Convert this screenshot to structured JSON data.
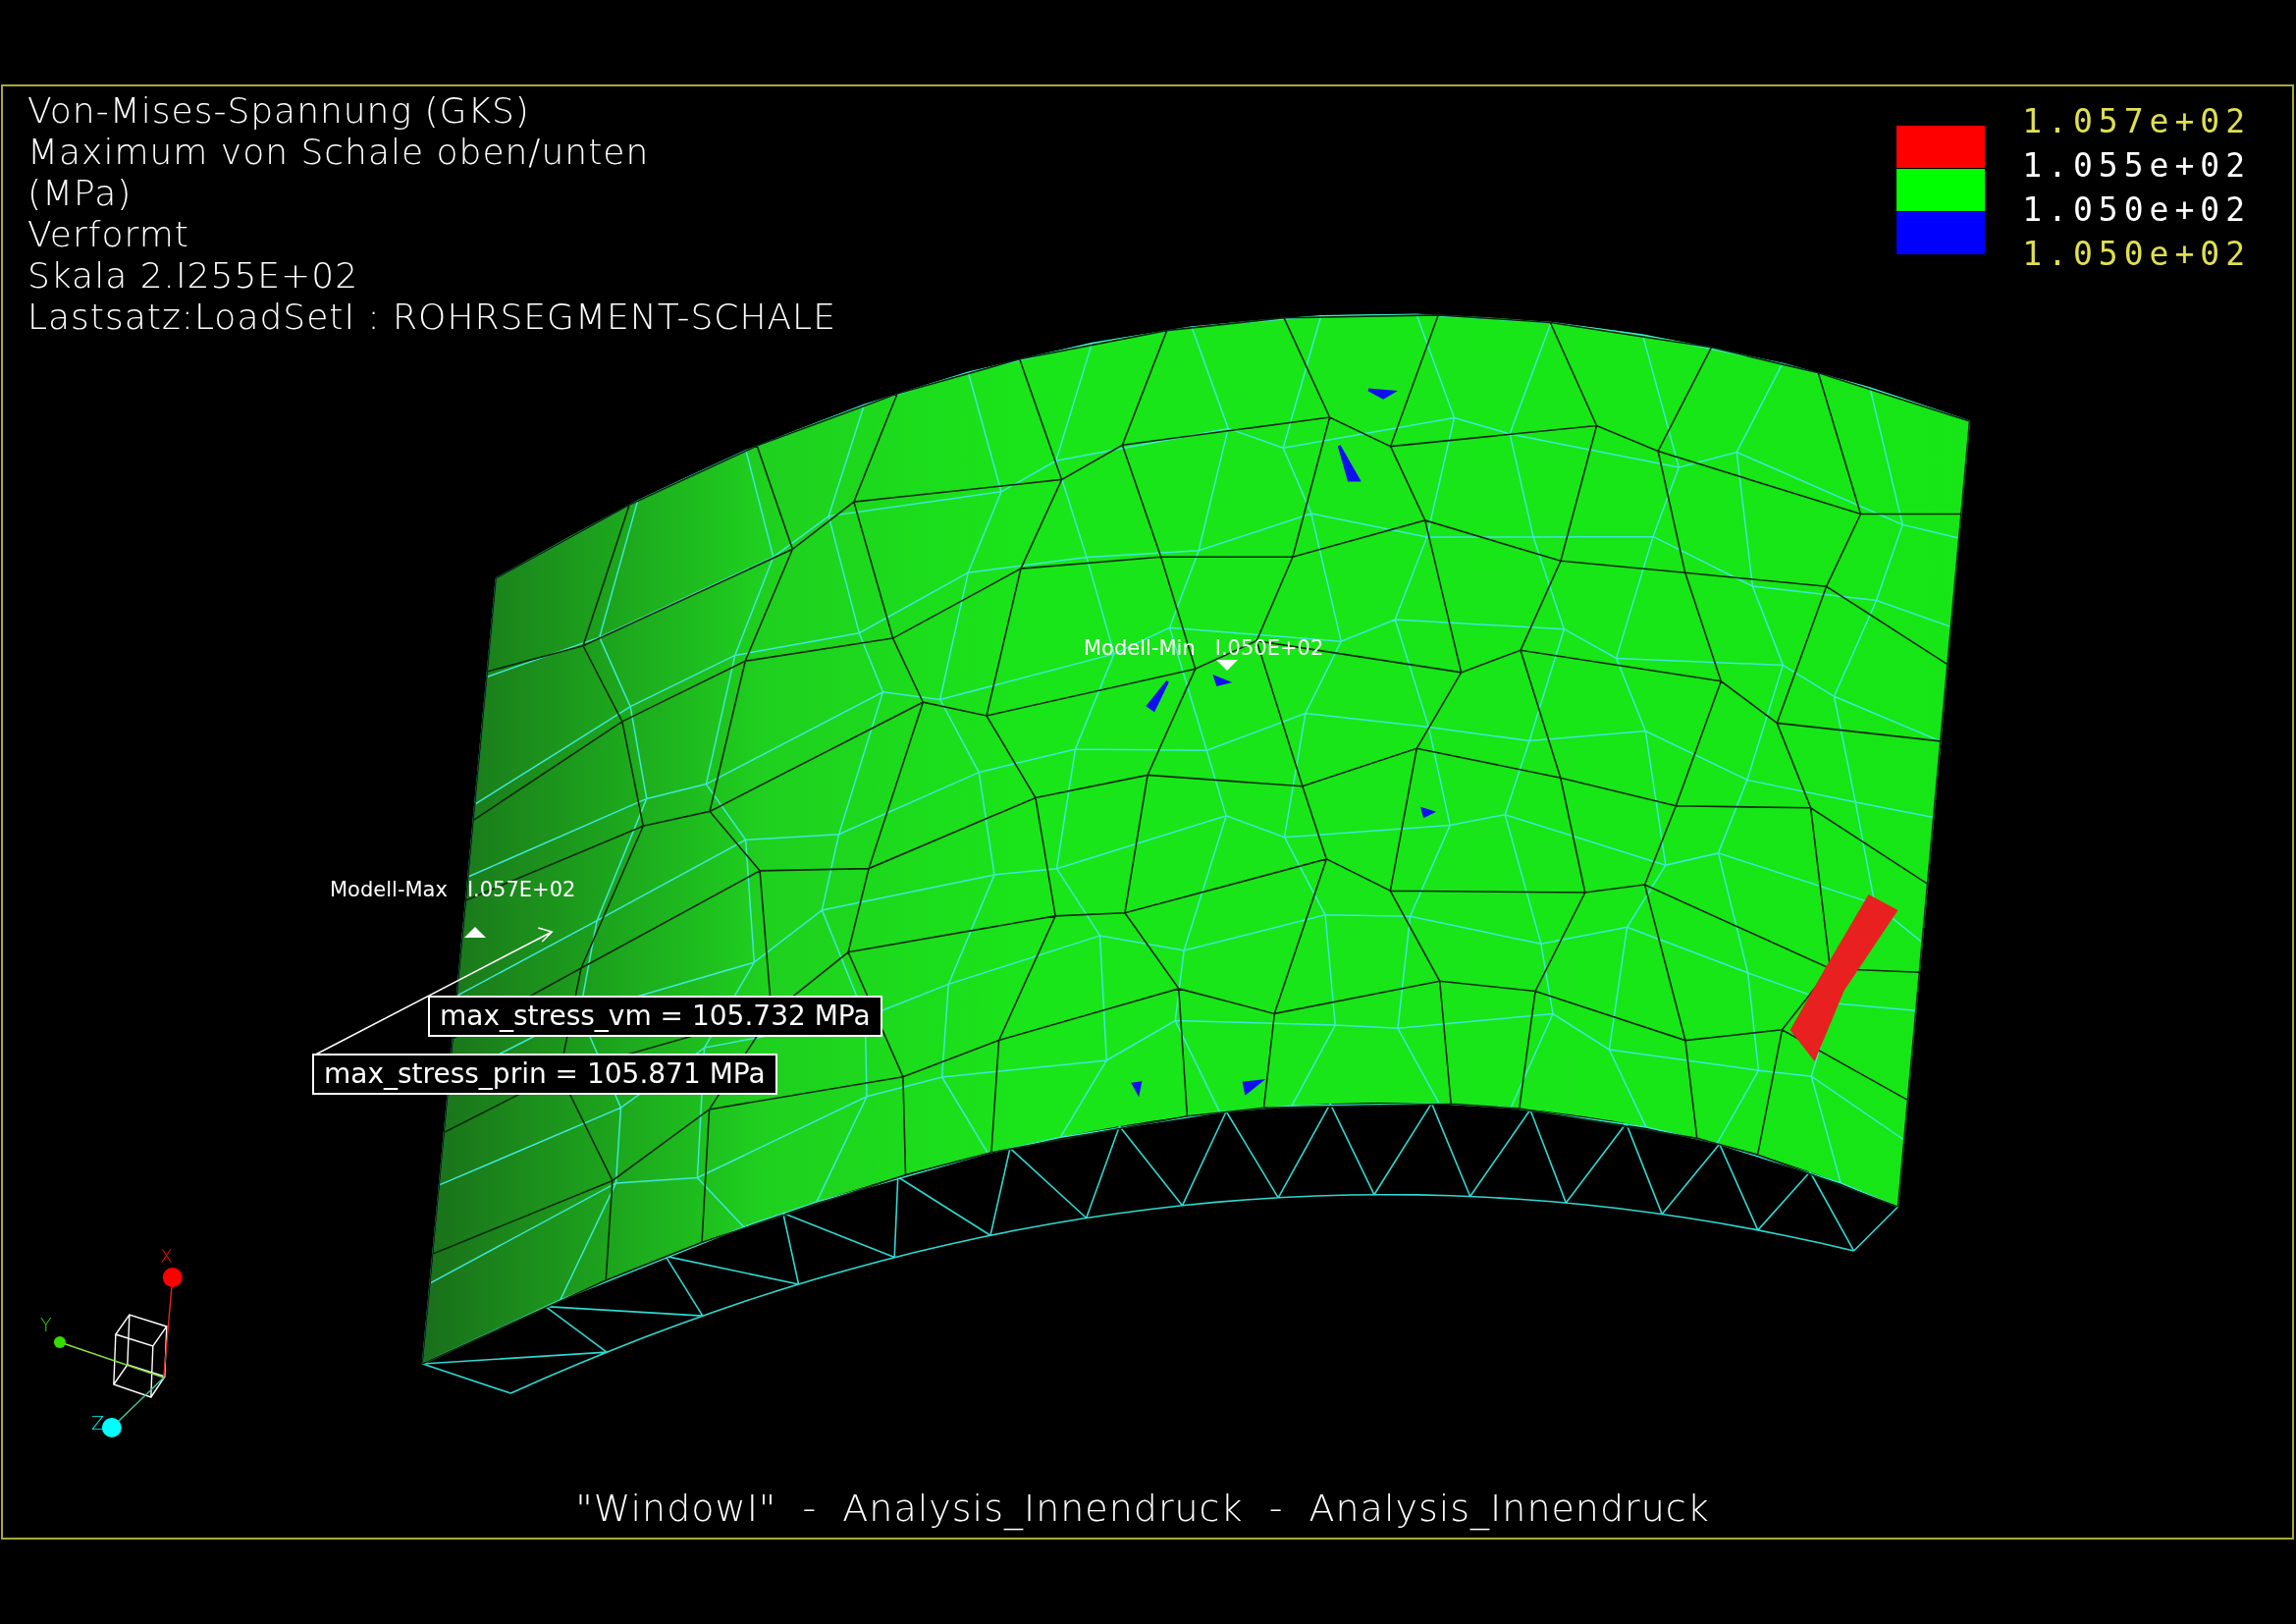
{
  "title_block": [
    "Von-Mises-Spannung (GKS)",
    "Maximum von Schale oben/unten",
    "(MPa)",
    "Verformt",
    "Skala  2.I255E+02",
    "Lastsatz:LoadSetI  :   ROHRSEGMENT-SCHALE"
  ],
  "legend": {
    "swatches": [
      {
        "color": "#ff0000"
      },
      {
        "color": "#00ff00"
      },
      {
        "color": "#0000ff"
      }
    ],
    "labels": [
      {
        "text": "1.057e+02",
        "kind": "limit"
      },
      {
        "text": "1.055e+02",
        "kind": "band"
      },
      {
        "text": "1.050e+02",
        "kind": "band"
      },
      {
        "text": "1.050e+02",
        "kind": "limit"
      }
    ]
  },
  "markers": [
    {
      "kind": "max",
      "label": "Modell-Max",
      "value": "I.057E+02"
    },
    {
      "kind": "min",
      "label": "Modell-Min",
      "value": "I.050E+02"
    }
  ],
  "annotations": [
    "max_stress_vm = 105.732  MPa",
    "max_stress_prin = 105.871  MPa"
  ],
  "axes": [
    {
      "label": "X",
      "color": "#ff0000"
    },
    {
      "label": "Y",
      "color": "#33dd00"
    },
    {
      "label": "Z",
      "color": "#00ffff"
    }
  ],
  "caption": "\"WindowI\"  -  Analysis_Innendruck  -  Analysis_Innendruck"
}
